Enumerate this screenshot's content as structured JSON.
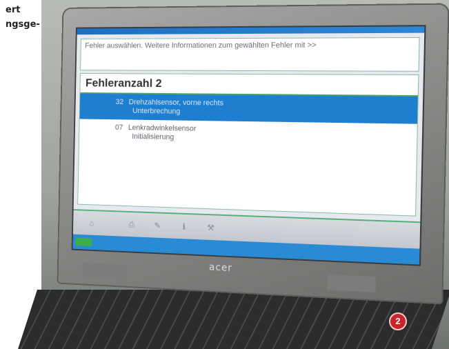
{
  "caption": {
    "line1": "ert",
    "line2": "ngsge-"
  },
  "laptop": {
    "brand": "acer"
  },
  "app": {
    "title": "",
    "instructions": "Fehler auswählen. Weitere Informationen zum gewählten Fehler mit >>",
    "fault_count_label": "Fehleranzahl 2",
    "faults": [
      {
        "code": "32",
        "line1": "Drehzahlsensor, vorne rechts",
        "line2": "Unterbrechung",
        "selected": true
      },
      {
        "code": "07",
        "line1": "Lenkradwinkelsensor",
        "line2": "Initialisierung",
        "selected": false
      }
    ],
    "toolbar_icons": [
      "home-icon",
      "print-icon",
      "edit-icon",
      "info-icon",
      "tools-icon"
    ]
  },
  "badge": {
    "number": "2"
  },
  "colors": {
    "selected_row": "#1e7fd0",
    "frame_green": "#4ba06a",
    "title_bar": "#1f6fc0",
    "badge_red": "#c8262b"
  }
}
